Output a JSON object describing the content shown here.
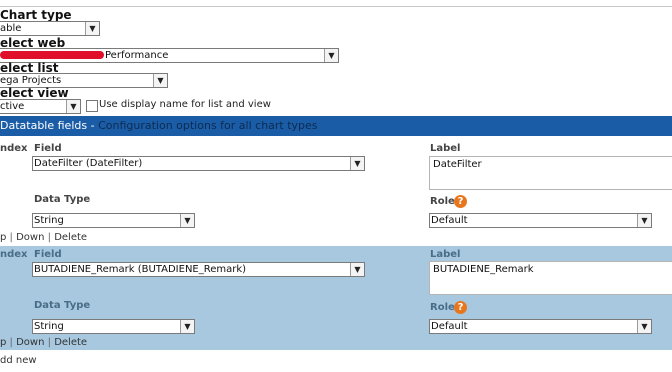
{
  "chart_type": {
    "heading": "Chart type",
    "value": "able"
  },
  "select_web": {
    "heading": "elect web",
    "value": "Performance"
  },
  "select_list": {
    "heading": "elect list",
    "value": "ega Projects"
  },
  "select_view": {
    "heading": "elect view",
    "value": "ctive",
    "checkbox_label": "Use display name for list and view",
    "checkbox_checked": false
  },
  "band": {
    "title": "Datatable fields",
    "separator": " - ",
    "subtitle": "Configuration options for all chart types"
  },
  "fields": [
    {
      "index_label": "ndex",
      "field_label": "Field",
      "field_value": "DateFilter (DateFilter)",
      "label_label": "Label",
      "label_value": "DateFilter",
      "datatype_label": "Data Type",
      "datatype_value": "String",
      "role_label": "Role",
      "role_value": "Default",
      "help_glyph": "?",
      "actions": {
        "up": "p",
        "down": "Down",
        "delete": "Delete"
      }
    },
    {
      "index_label": "ndex",
      "field_label": "Field",
      "field_value": "BUTADIENE_Remark (BUTADIENE_Remark)",
      "label_label": "Label",
      "label_value": "BUTADIENE_Remark",
      "datatype_label": "Data Type",
      "datatype_value": "String",
      "role_label": "Role",
      "role_value": "Default",
      "help_glyph": "?",
      "actions": {
        "up": "p",
        "down": "Down",
        "delete": "Delete"
      }
    }
  ],
  "add_new": "dd new",
  "icons": {
    "dropdown": "chevron-down-icon",
    "help": "help-icon"
  },
  "colors": {
    "band": "#1a5da6",
    "row_highlight": "#a8c8e0",
    "help": "#e8761c",
    "redaction": "#e0102a"
  }
}
